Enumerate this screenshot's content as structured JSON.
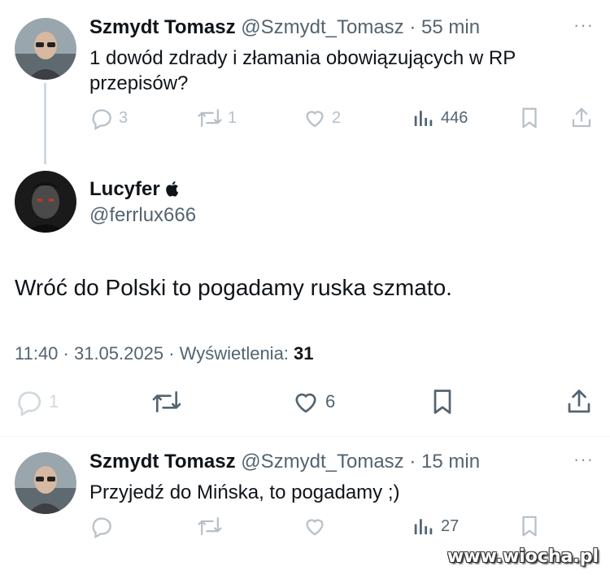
{
  "tweet1": {
    "name": "Szmydt Tomasz",
    "handle": "@Szmydt_Tomasz",
    "separator": " · ",
    "time": "55 min",
    "more": "···",
    "text": "1 dowód zdrady i złamania obowiązujących w RP przepisów?",
    "replies": "3",
    "retweets": "1",
    "likes": "2",
    "views": "446"
  },
  "tweet2": {
    "name": "Lucyfer",
    "name_badge": "apple-icon",
    "handle": "@ferrlux666",
    "text": "Wróć do Polski to pogadamy ruska szmato.",
    "meta_time": "11:40 · 31.05.2025 · Wyświetlenia: ",
    "views": "31",
    "replies": "1",
    "likes": "6"
  },
  "tweet3": {
    "name": "Szmydt Tomasz",
    "handle": "@Szmydt_Tomasz",
    "separator": " · ",
    "time": "15 min",
    "more": "···",
    "text": "Przyjedź do Mińska, to pogadamy ;)",
    "views": "27"
  },
  "watermark": "www.wiocha.pl",
  "colors": {
    "text": "#0f1419",
    "muted": "#536471",
    "faded_icons": "#b6c0c8",
    "thread_line": "#cfd9de"
  }
}
